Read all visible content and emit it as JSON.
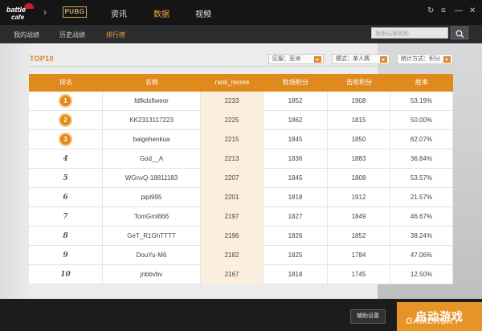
{
  "app": {
    "logo_line1": "battle",
    "logo_line2": "cafe",
    "game_badge": "PUBG"
  },
  "nav": {
    "tabs": [
      {
        "label": "资讯",
        "active": false
      },
      {
        "label": "数据",
        "active": true
      },
      {
        "label": "视频",
        "active": false
      }
    ]
  },
  "subnav": {
    "tabs": [
      {
        "label": "我的战绩",
        "active": false
      },
      {
        "label": "历史战绩",
        "active": false
      },
      {
        "label": "排行榜",
        "active": true
      }
    ],
    "search_placeholder": "搜索玩家昵称"
  },
  "leaderboard": {
    "title": "TOP10",
    "filters": {
      "region": "区服：亚洲",
      "mode": "模式：单人赛",
      "sort": "统计方式：积分"
    },
    "columns": [
      "排名",
      "名称",
      "rank_recore",
      "胜场积分",
      "击败积分",
      "胜率"
    ],
    "rows": [
      {
        "rank": "1",
        "name": "fdfkdsfiweor",
        "rank_recore": "2233",
        "win_points": "1852",
        "kill_points": "1908",
        "win_rate": "53.19%"
      },
      {
        "rank": "2",
        "name": "KK2313117223",
        "rank_recore": "2225",
        "win_points": "1862",
        "kill_points": "1815",
        "win_rate": "50.00%"
      },
      {
        "rank": "3",
        "name": "baigehenkua",
        "rank_recore": "2215",
        "win_points": "1845",
        "kill_points": "1850",
        "win_rate": "62.07%"
      },
      {
        "rank": "4",
        "name": "God__A",
        "rank_recore": "2213",
        "win_points": "1836",
        "kill_points": "1883",
        "win_rate": "36.84%"
      },
      {
        "rank": "5",
        "name": "WGnvQ-18811183",
        "rank_recore": "2207",
        "win_points": "1845",
        "kill_points": "1808",
        "win_rate": "53.57%"
      },
      {
        "rank": "6",
        "name": "pipi995",
        "rank_recore": "2201",
        "win_points": "1818",
        "kill_points": "1912",
        "win_rate": "21.57%"
      },
      {
        "rank": "7",
        "name": "TomGml666",
        "rank_recore": "2197",
        "win_points": "1827",
        "kill_points": "1849",
        "win_rate": "46.67%"
      },
      {
        "rank": "8",
        "name": "GeT_R1GhTTTT",
        "rank_recore": "2196",
        "win_points": "1826",
        "kill_points": "1852",
        "win_rate": "38.24%"
      },
      {
        "rank": "9",
        "name": "DouYu-M6",
        "rank_recore": "2182",
        "win_points": "1825",
        "kill_points": "1784",
        "win_rate": "47.06%"
      },
      {
        "rank": "10",
        "name": "jnbbvbv",
        "rank_recore": "2167",
        "win_points": "1818",
        "kill_points": "1745",
        "win_rate": "12.50%"
      }
    ]
  },
  "footer": {
    "assist_label": "辅助设置",
    "launch_label": "启动游戏",
    "watermark": "GAMERSKY"
  },
  "colors": {
    "accent": "#e08a1e",
    "highlight_col": "#fbeedd"
  },
  "icons": {
    "refresh": "refresh-icon",
    "menu": "menu-icon",
    "minimize": "minimize-icon",
    "close": "close-icon",
    "search": "search-icon"
  }
}
